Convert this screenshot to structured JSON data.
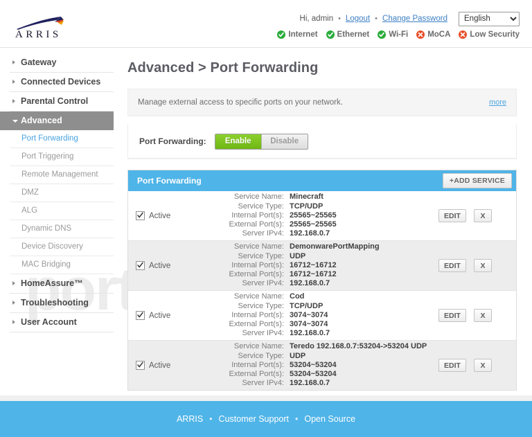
{
  "header": {
    "logo_text": "ARRIS",
    "greeting": "Hi, admin",
    "sep": "•",
    "logout_label": "Logout",
    "change_password_label": "Change Password",
    "language_selected": "English",
    "language_options": [
      "English"
    ],
    "status": [
      {
        "label": "Internet",
        "state": "ok",
        "icon": "check-circle-icon"
      },
      {
        "label": "Ethernet",
        "state": "ok",
        "icon": "check-circle-icon"
      },
      {
        "label": "Wi-Fi",
        "state": "ok",
        "icon": "check-circle-icon"
      },
      {
        "label": "MoCA",
        "state": "bad",
        "icon": "x-circle-icon"
      },
      {
        "label": "Low Security",
        "state": "bad",
        "icon": "x-circle-icon"
      }
    ],
    "colors": {
      "ok": "#2bab3b",
      "bad": "#e8502a"
    }
  },
  "sidebar": {
    "top_items": [
      {
        "label": "Gateway",
        "expanded": false
      },
      {
        "label": "Connected Devices",
        "expanded": false
      },
      {
        "label": "Parental Control",
        "expanded": false
      },
      {
        "label": "Advanced",
        "expanded": true
      }
    ],
    "advanced_sub_items": [
      {
        "label": "Port Forwarding",
        "selected": true
      },
      {
        "label": "Port Triggering",
        "selected": false
      },
      {
        "label": "Remote Management",
        "selected": false
      },
      {
        "label": "DMZ",
        "selected": false
      },
      {
        "label": "ALG",
        "selected": false
      },
      {
        "label": "Dynamic DNS",
        "selected": false
      },
      {
        "label": "Device Discovery",
        "selected": false
      },
      {
        "label": "MAC Bridging",
        "selected": false
      }
    ],
    "bottom_items": [
      {
        "label": "HomeAssure™",
        "expanded": false
      },
      {
        "label": "Troubleshooting",
        "expanded": false
      },
      {
        "label": "User Account",
        "expanded": false
      }
    ]
  },
  "main": {
    "page_title": "Advanced > Port Forwarding",
    "description": "Manage external access to specific ports on your network.",
    "more_label": "more",
    "toggle": {
      "label": "Port Forwarding:",
      "enable_label": "Enable",
      "disable_label": "Disable",
      "selected": "Enable",
      "enable_color": "#79c11f"
    },
    "panel": {
      "title": "Port Forwarding",
      "add_service_label": "+ADD SERVICE",
      "header_color": "#4fb4e8",
      "field_labels": {
        "service_name": "Service Name:",
        "service_type": "Service Type:",
        "internal_ports": "Internal Port(s):",
        "external_ports": "External Port(s):",
        "server_ipv4": "Server IPv4:"
      },
      "active_label": "Active",
      "edit_label": "EDIT",
      "delete_label": "X",
      "rows": [
        {
          "active": true,
          "service_name": "Minecraft",
          "service_type": "TCP/UDP",
          "internal_ports": "25565~25565",
          "external_ports": "25565~25565",
          "server_ipv4": "192.168.0.7"
        },
        {
          "active": true,
          "service_name": "DemonwarePortMapping",
          "service_type": "UDP",
          "internal_ports": "16712~16712",
          "external_ports": "16712~16712",
          "server_ipv4": "192.168.0.7"
        },
        {
          "active": true,
          "service_name": "Cod",
          "service_type": "TCP/UDP",
          "internal_ports": "3074~3074",
          "external_ports": "3074~3074",
          "server_ipv4": "192.168.0.7"
        },
        {
          "active": true,
          "service_name": "Teredo 192.168.0.7:53204->53204 UDP",
          "service_type": "UDP",
          "internal_ports": "53204~53204",
          "external_ports": "53204~53204",
          "server_ipv4": "192.168.0.7"
        }
      ]
    }
  },
  "watermark": {
    "text": "portforward"
  },
  "footer": {
    "brand": "ARRIS",
    "sep": "•",
    "customer_support": "Customer Support",
    "open_source": "Open Source",
    "background": "#4fb4e8"
  }
}
